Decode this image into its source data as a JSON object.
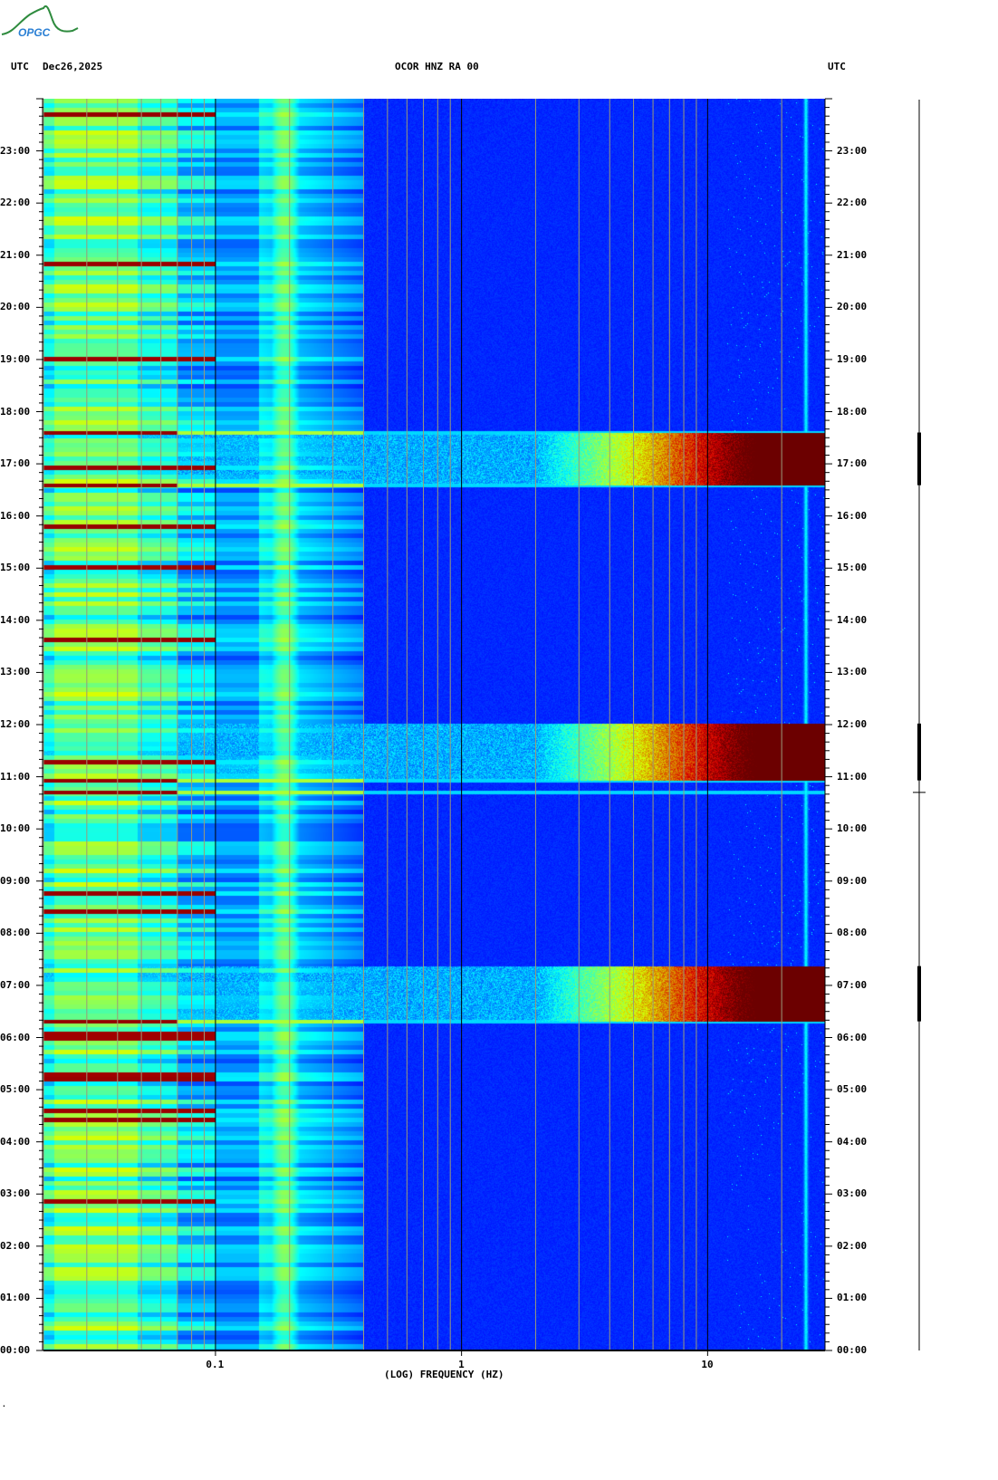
{
  "header": {
    "logo_text": "OPGC",
    "left_label": "UTC",
    "date": "Dec26,2025",
    "station": "OCOR HNZ RA 00",
    "right_label": "UTC"
  },
  "chart_data": {
    "type": "heatmap",
    "title": "OCOR HNZ RA 00",
    "xlabel": "(LOG) FREQUENCY (HZ)",
    "ylabel": "UTC",
    "x_scale": "log",
    "xlim": [
      0.02,
      30
    ],
    "ylim": [
      0,
      24
    ],
    "x_tick_values": [
      0.1,
      1,
      10
    ],
    "x_tick_labels": [
      "0.1",
      "1",
      "10"
    ],
    "y_tick_labels": [
      "00:00",
      "01:00",
      "02:00",
      "03:00",
      "04:00",
      "05:00",
      "06:00",
      "07:00",
      "08:00",
      "09:00",
      "10:00",
      "11:00",
      "12:00",
      "13:00",
      "14:00",
      "15:00",
      "16:00",
      "17:00",
      "18:00",
      "19:00",
      "20:00",
      "21:00",
      "22:00",
      "23:00"
    ],
    "y_minor_tick_minutes": 10,
    "grid": "vertical log gridlines",
    "colormap": "jet",
    "background_level": 0.12,
    "microseism_peak_hz": 0.19,
    "persistent_line_hz": 25,
    "events": [
      {
        "start_h": 6.31,
        "end_h": 7.37,
        "min_hz": 5,
        "intensity": 1.0
      },
      {
        "start_h": 10.93,
        "end_h": 12.02,
        "min_hz": 5,
        "intensity": 1.0
      },
      {
        "start_h": 16.59,
        "end_h": 17.6,
        "min_hz": 5,
        "intensity": 1.0
      }
    ],
    "broadband_lines_h": [
      6.31,
      10.93,
      16.59,
      17.6,
      10.7
    ]
  },
  "colors": {
    "background": "#ffffff",
    "grid_minor": "#9a9a7a",
    "grid_major": "#000000",
    "logo_green": "#2e8b3e",
    "logo_blue": "#2a7fd4"
  },
  "footer": {
    "mark": "."
  }
}
